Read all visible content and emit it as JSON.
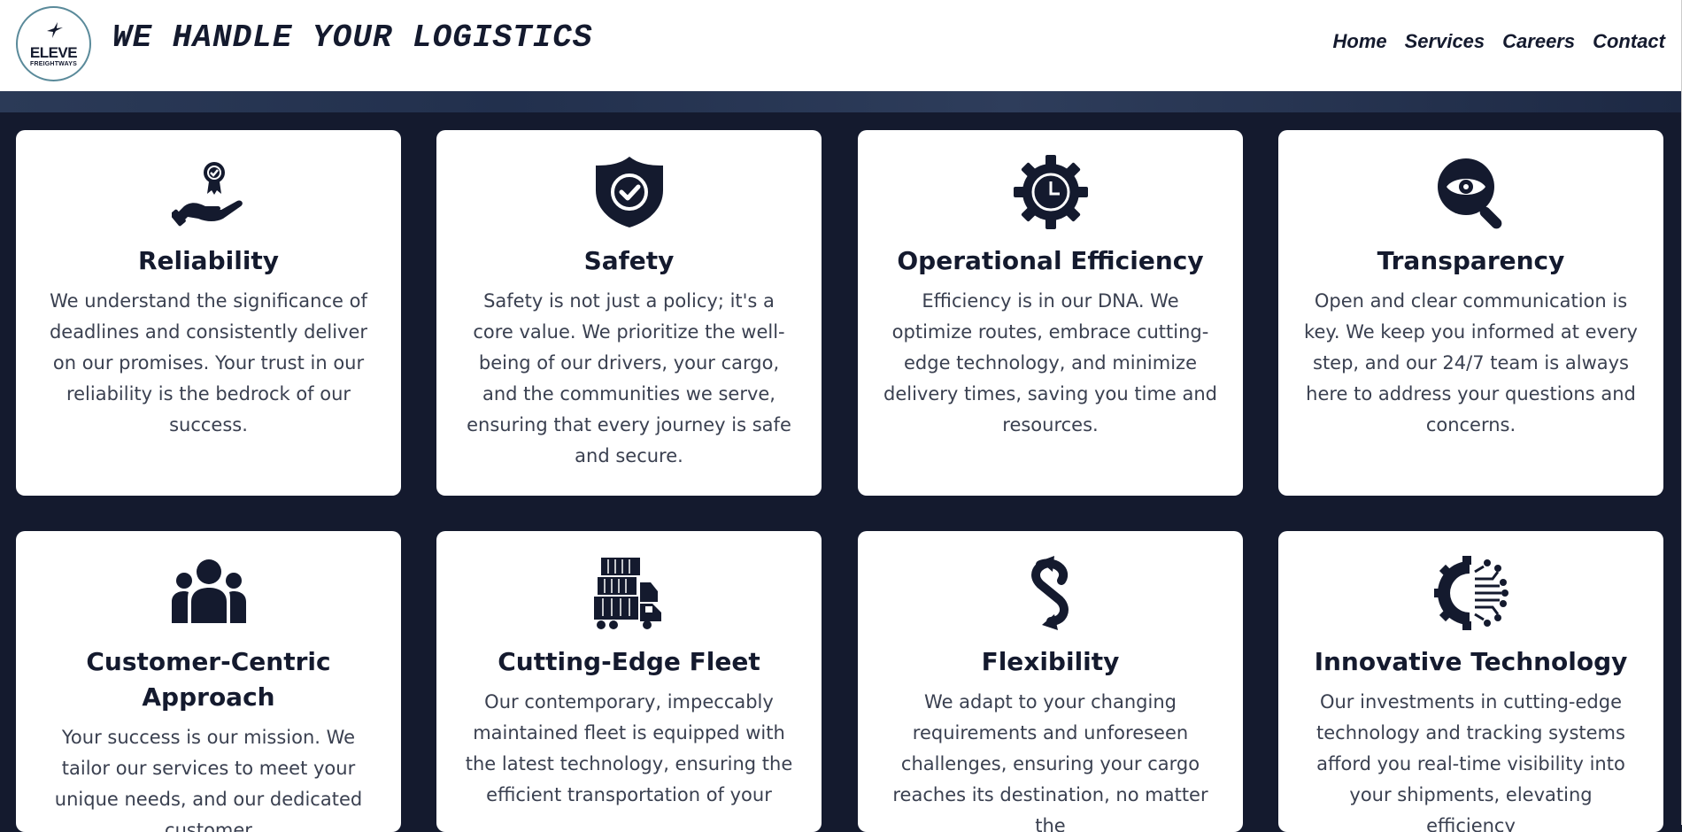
{
  "header": {
    "logo": {
      "name": "ELEVE",
      "sub": "FREIGHTWAYS"
    },
    "tagline": "WE HANDLE YOUR LOGISTICS",
    "nav": [
      "Home",
      "Services",
      "Careers",
      "Contact"
    ]
  },
  "colors": {
    "navy": "#141a2e",
    "card_bg": "#ffffff",
    "text": "#3a4050"
  },
  "cards": [
    {
      "icon": "award-hand-icon",
      "title": "Reliability",
      "text": "We understand the significance of deadlines and consistently deliver on our promises. Your trust in our reliability is the bedrock of our success."
    },
    {
      "icon": "shield-check-icon",
      "title": "Safety",
      "text": "Safety is not just a policy; it's a core value. We prioritize the well-being of our drivers, your cargo, and the communities we serve, ensuring that every journey is safe and secure."
    },
    {
      "icon": "gear-clock-icon",
      "title": "Operational Efficiency",
      "text": "Efficiency is in our DNA. We optimize routes, embrace cutting-edge technology, and minimize delivery times, saving you time and resources."
    },
    {
      "icon": "eye-magnifier-icon",
      "title": "Transparency",
      "text": "Open and clear communication is key. We keep you informed at every step, and our 24/7 team is always here to address your questions and concerns."
    },
    {
      "icon": "people-group-icon",
      "title": "Customer-Centric Approach",
      "text": "Your success is our mission. We tailor our services to meet your unique needs, and our dedicated customer"
    },
    {
      "icon": "truck-fleet-icon",
      "title": "Cutting-Edge Fleet",
      "text": "Our contemporary, impeccably maintained fleet is equipped with the latest technology, ensuring the efficient transportation of your"
    },
    {
      "icon": "flexible-arrow-icon",
      "title": "Flexibility",
      "text": "We adapt to your changing requirements and unforeseen challenges, ensuring your cargo reaches its destination, no matter the"
    },
    {
      "icon": "gear-circuit-icon",
      "title": "Innovative Technology",
      "text": "Our investments in cutting-edge technology and tracking systems afford you real-time visibility into your shipments, elevating efficiency"
    }
  ]
}
